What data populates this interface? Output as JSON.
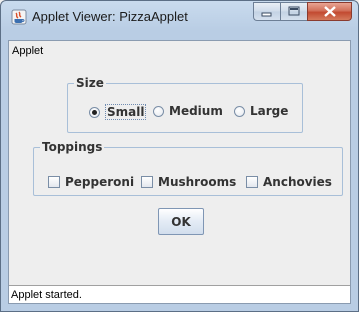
{
  "window": {
    "title": "Applet Viewer: PizzaApplet"
  },
  "menu": {
    "applet_label": "Applet"
  },
  "size_group": {
    "legend": "Size",
    "options": [
      {
        "label": "Small",
        "checked": true
      },
      {
        "label": "Medium",
        "checked": false
      },
      {
        "label": "Large",
        "checked": false
      }
    ]
  },
  "toppings_group": {
    "legend": "Toppings",
    "options": [
      {
        "label": "Pepperoni",
        "checked": false
      },
      {
        "label": "Mushrooms",
        "checked": false
      },
      {
        "label": "Anchovies",
        "checked": false
      }
    ]
  },
  "ok_button": {
    "label": "OK"
  },
  "status": {
    "text": "Applet started."
  },
  "icons": {
    "app": "java-applet-icon",
    "minimize": "minimize-icon",
    "maximize": "maximize-icon",
    "close": "close-icon"
  },
  "colors": {
    "title_bar": "#b9cde4",
    "close_button": "#c24a31",
    "group_border": "#a8bfd8"
  }
}
